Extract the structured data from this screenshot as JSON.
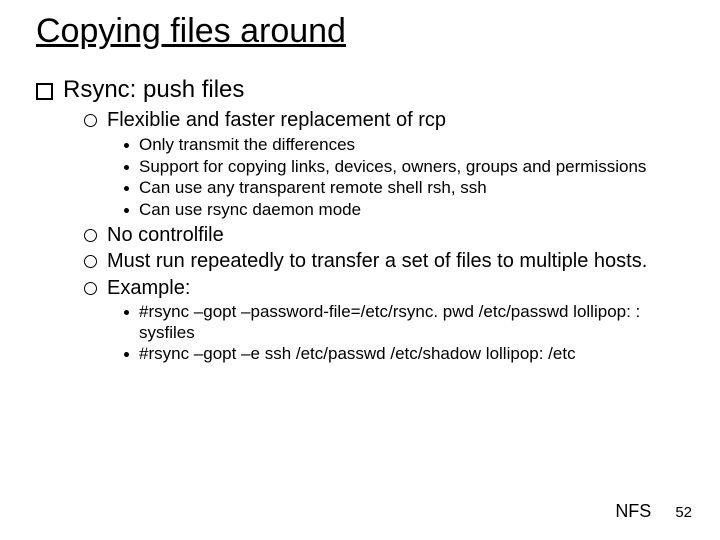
{
  "title": "Copying files around",
  "bullet1": {
    "text": "Rsync: push files",
    "subs": [
      {
        "text": "Flexiblie and faster replacement of rcp",
        "points": [
          "Only transmit the differences",
          "Support for copying links, devices, owners, groups and permissions",
          "Can use any transparent remote shell rsh, ssh",
          "Can use rsync daemon mode"
        ]
      },
      {
        "text": "No controlfile",
        "points": []
      },
      {
        "text": "Must run repeatedly to transfer a set of files to multiple hosts.",
        "points": []
      },
      {
        "text": "Example:",
        "points": [
          "#rsync –gopt –password-file=/etc/rsync. pwd /etc/passwd lollipop: : sysfiles",
          "#rsync –gopt –e ssh /etc/passwd /etc/shadow lollipop: /etc"
        ]
      }
    ]
  },
  "footer": {
    "label": "NFS",
    "page": "52"
  }
}
